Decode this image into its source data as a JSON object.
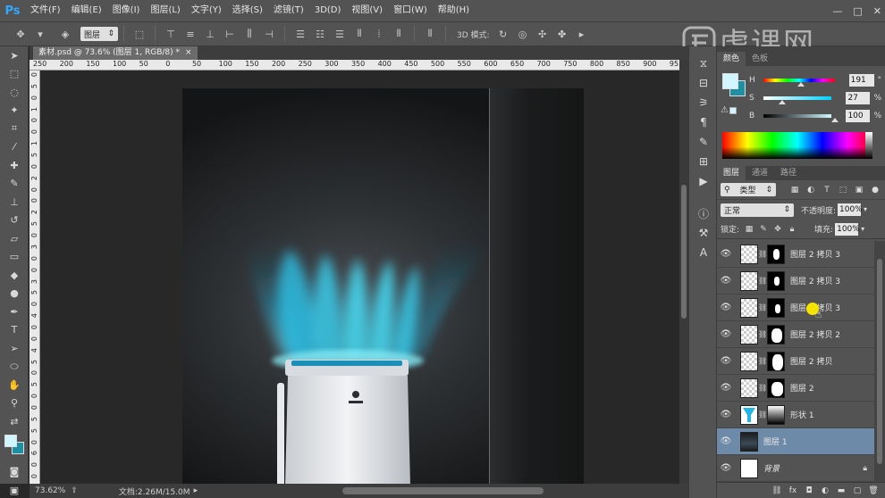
{
  "app": {
    "logo": "Ps"
  },
  "menubar": {
    "items": [
      "文件(F)",
      "编辑(E)",
      "图像(I)",
      "图层(L)",
      "文字(Y)",
      "选择(S)",
      "滤镜(T)",
      "3D(D)",
      "视图(V)",
      "窗口(W)",
      "帮助(H)"
    ],
    "window_controls": [
      "—",
      "□",
      "✕"
    ]
  },
  "optionsbar": {
    "layer_select": "图层",
    "mode3d_label": "3D 模式:"
  },
  "watermark": {
    "text": "虎课网"
  },
  "document": {
    "tab_title": "素材.psd @ 73.6% (图层 1, RGB/8) *",
    "close": "×"
  },
  "rulers": {
    "top_labels": [
      "250",
      "200",
      "150",
      "100",
      "50",
      "0",
      "50",
      "100",
      "150",
      "200",
      "250",
      "300",
      "350",
      "400",
      "450",
      "500",
      "550",
      "600",
      "650",
      "700",
      "750",
      "800",
      "850",
      "900",
      "95"
    ],
    "left_labels": [
      "0",
      "5",
      "0",
      "1",
      "0",
      "0",
      "1",
      "5",
      "0",
      "2",
      "0",
      "0",
      "2",
      "5",
      "0",
      "3",
      "0",
      "0",
      "3",
      "5",
      "0",
      "4",
      "0",
      "0",
      "4",
      "5",
      "0",
      "5",
      "0",
      "0",
      "5",
      "5",
      "0",
      "6",
      "0",
      "0"
    ]
  },
  "statusbar": {
    "zoom": "73.62%",
    "doc_info": "文档:2.26M/15.0M"
  },
  "color_panel": {
    "tabs": [
      "颜色",
      "色板"
    ],
    "fg_color": "#d2f6ff",
    "bg_color": "#1f8fa3",
    "sliders": [
      {
        "label": "H",
        "value": "191",
        "unit": "°",
        "fraction": 0.53
      },
      {
        "label": "S",
        "value": "27",
        "unit": "%",
        "fraction": 0.27
      },
      {
        "label": "B",
        "value": "100",
        "unit": "%",
        "fraction": 1.0
      }
    ]
  },
  "layers_panel": {
    "tabs": [
      "图层",
      "通道",
      "路径"
    ],
    "filter_select": "类型",
    "blend_mode": "正常",
    "opacity_label": "不透明度:",
    "opacity_value": "100%",
    "lock_label": "锁定:",
    "fill_label": "填充:",
    "fill_value": "100%",
    "layers": [
      {
        "name": "图层 2 拷贝 3",
        "kind": "masked",
        "selected": false
      },
      {
        "name": "图层 2 拷贝 3",
        "kind": "masked",
        "selected": false
      },
      {
        "name": "图层 2 拷贝 3",
        "kind": "masked",
        "selected": false
      },
      {
        "name": "图层 2 拷贝 2",
        "kind": "masked",
        "selected": false
      },
      {
        "name": "图层 2 拷贝",
        "kind": "masked",
        "selected": false
      },
      {
        "name": "图层 2",
        "kind": "masked",
        "selected": false
      },
      {
        "name": "形状 1",
        "kind": "shape",
        "selected": false
      },
      {
        "name": "图层 1",
        "kind": "image",
        "selected": true
      },
      {
        "name": "背景",
        "kind": "background",
        "selected": false,
        "locked": true
      }
    ],
    "footer_icons": [
      "link-icon",
      "fx-icon",
      "mask-icon",
      "adjustment-icon",
      "folder-icon",
      "new-layer-icon",
      "trash-icon"
    ]
  },
  "accent": {
    "selection": "#6d8aa8",
    "glow": "#2fc8ec"
  }
}
